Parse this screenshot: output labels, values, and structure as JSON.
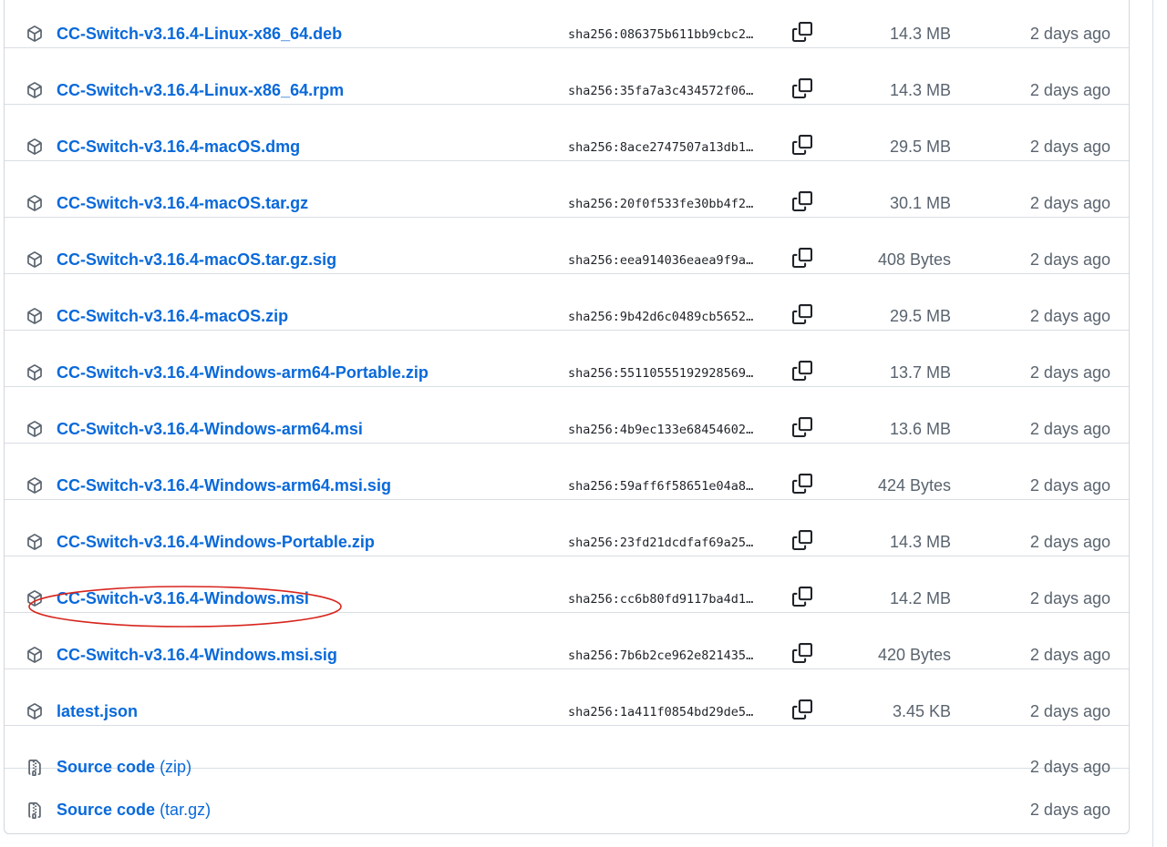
{
  "assets": [
    {
      "name": "CC-Switch-v3.16.4-Linux-x86_64.deb",
      "sha": "sha256:086375b611bb9cbc2…",
      "size": "14.3 MB",
      "date": "2 days ago"
    },
    {
      "name": "CC-Switch-v3.16.4-Linux-x86_64.rpm",
      "sha": "sha256:35fa7a3c434572f06…",
      "size": "14.3 MB",
      "date": "2 days ago"
    },
    {
      "name": "CC-Switch-v3.16.4-macOS.dmg",
      "sha": "sha256:8ace2747507a13db1…",
      "size": "29.5 MB",
      "date": "2 days ago"
    },
    {
      "name": "CC-Switch-v3.16.4-macOS.tar.gz",
      "sha": "sha256:20f0f533fe30bb4f2…",
      "size": "30.1 MB",
      "date": "2 days ago"
    },
    {
      "name": "CC-Switch-v3.16.4-macOS.tar.gz.sig",
      "sha": "sha256:eea914036eaea9f9a…",
      "size": "408 Bytes",
      "date": "2 days ago"
    },
    {
      "name": "CC-Switch-v3.16.4-macOS.zip",
      "sha": "sha256:9b42d6c0489cb5652…",
      "size": "29.5 MB",
      "date": "2 days ago"
    },
    {
      "name": "CC-Switch-v3.16.4-Windows-arm64-Portable.zip",
      "sha": "sha256:55110555192928569…",
      "size": "13.7 MB",
      "date": "2 days ago"
    },
    {
      "name": "CC-Switch-v3.16.4-Windows-arm64.msi",
      "sha": "sha256:4b9ec133e68454602…",
      "size": "13.6 MB",
      "date": "2 days ago"
    },
    {
      "name": "CC-Switch-v3.16.4-Windows-arm64.msi.sig",
      "sha": "sha256:59aff6f58651e04a8…",
      "size": "424 Bytes",
      "date": "2 days ago"
    },
    {
      "name": "CC-Switch-v3.16.4-Windows-Portable.zip",
      "sha": "sha256:23fd21dcdfaf69a25…",
      "size": "14.3 MB",
      "date": "2 days ago"
    },
    {
      "name": "CC-Switch-v3.16.4-Windows.msi",
      "sha": "sha256:cc6b80fd9117ba4d1…",
      "size": "14.2 MB",
      "date": "2 days ago"
    },
    {
      "name": "CC-Switch-v3.16.4-Windows.msi.sig",
      "sha": "sha256:7b6b2ce962e821435…",
      "size": "420 Bytes",
      "date": "2 days ago"
    },
    {
      "name": "latest.json",
      "sha": "sha256:1a411f0854bd29de5…",
      "size": "3.45 KB",
      "date": "2 days ago"
    }
  ],
  "source_code": [
    {
      "label": "Source code",
      "format": "(zip)",
      "date": "2 days ago"
    },
    {
      "label": "Source code",
      "format": "(tar.gz)",
      "date": "2 days ago"
    }
  ],
  "icons": {
    "asset": "package-icon",
    "source": "file-zip-icon",
    "copy": "copy-icon"
  },
  "colors": {
    "link": "#0969da",
    "muted": "#59636e",
    "border": "#d8dee4",
    "annotation": "#d7261e"
  }
}
